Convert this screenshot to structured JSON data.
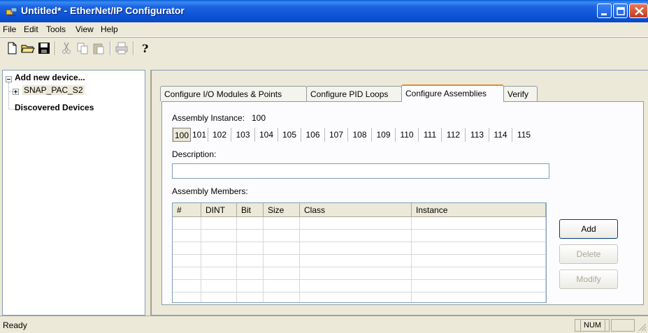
{
  "window": {
    "title": "Untitled* - EtherNet/IP Configurator",
    "controls": {
      "minimize_icon": "minimize-icon",
      "maximize_icon": "maximize-icon",
      "close_icon": "close-icon"
    }
  },
  "menubar": {
    "items": [
      "File",
      "Edit",
      "Tools",
      "View",
      "Help"
    ]
  },
  "toolbar": {
    "buttons": [
      {
        "icon": "new-document-icon",
        "enabled": true
      },
      {
        "icon": "open-folder-icon",
        "enabled": true
      },
      {
        "icon": "save-disk-icon",
        "enabled": true
      },
      {
        "icon": "cut-icon",
        "enabled": false
      },
      {
        "icon": "copy-icon",
        "enabled": false
      },
      {
        "icon": "paste-icon",
        "enabled": false
      },
      {
        "icon": "print-icon",
        "enabled": false
      },
      {
        "icon": "help-icon",
        "enabled": true
      }
    ]
  },
  "tree": {
    "root_label": "Add new device...",
    "child_label": "SNAP_PAC_S2",
    "discovered_label": "Discovered Devices"
  },
  "tabs": [
    {
      "label": "Configure I/O Modules & Points",
      "active": false
    },
    {
      "label": "Configure PID Loops",
      "active": false
    },
    {
      "label": "Configure Assemblies",
      "active": true
    },
    {
      "label": "Verify",
      "active": false
    }
  ],
  "assemblies": {
    "instance_label": "Assembly Instance:",
    "instance_value": "100",
    "instances": [
      "100",
      "101",
      "102",
      "103",
      "104",
      "105",
      "106",
      "107",
      "108",
      "109",
      "110",
      "111",
      "112",
      "113",
      "114",
      "115"
    ],
    "selected_instance": "100",
    "description_label": "Description:",
    "description_value": "",
    "members_label": "Assembly Members:",
    "columns": [
      "#",
      "DINT",
      "Bit",
      "Size",
      "Class",
      "Instance"
    ],
    "rows": []
  },
  "buttons": {
    "add": {
      "label": "Add",
      "enabled": true
    },
    "delete": {
      "label": "Delete",
      "enabled": false
    },
    "modify": {
      "label": "Modify",
      "enabled": false
    }
  },
  "statusbar": {
    "text": "Ready",
    "num_indicator": "NUM"
  },
  "colors": {
    "titlebar": "#0a5fd8",
    "window_bg": "#ece9d8",
    "active_tab_accent": "#e68b2c",
    "disabled_text": "#aca899"
  }
}
